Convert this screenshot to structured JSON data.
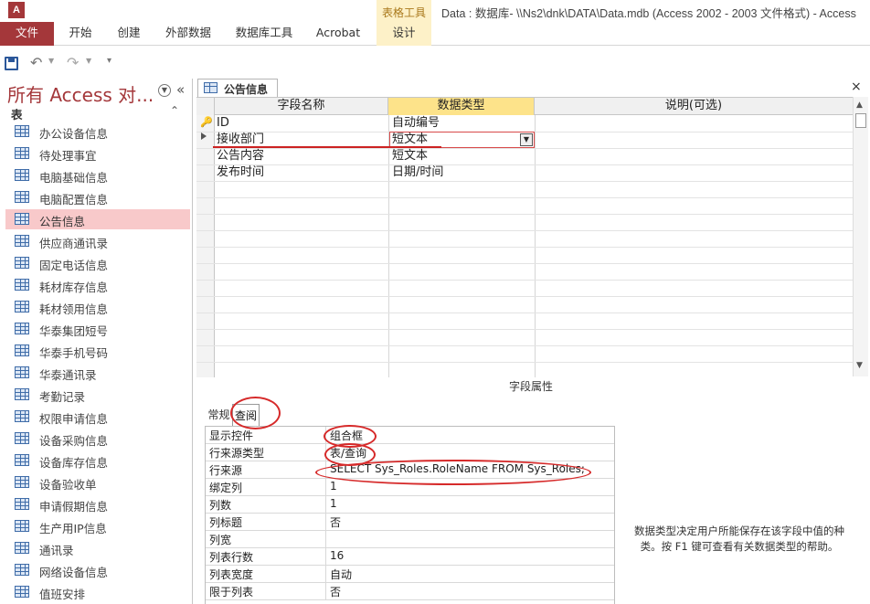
{
  "window": {
    "app_icon": "A",
    "title": "Data : 数据库- \\\\Ns2\\dnk\\DATA\\Data.mdb (Access 2002 - 2003 文件格式) - Access"
  },
  "ribbon": {
    "context_group": "表格工具",
    "tabs": {
      "file": "文件",
      "home": "开始",
      "create": "创建",
      "external": "外部数据",
      "dbtools": "数据库工具",
      "acrobat": "Acrobat",
      "design": "设计"
    }
  },
  "qat": {
    "icons": [
      "save-icon",
      "undo-icon",
      "redo-icon",
      "customize-icon"
    ]
  },
  "nav": {
    "title": "所有 Access 对...",
    "group_label": "表",
    "items": [
      "办公设备信息",
      "待处理事宜",
      "电脑基础信息",
      "电脑配置信息",
      "公告信息",
      "供应商通讯录",
      "固定电话信息",
      "耗材库存信息",
      "耗材领用信息",
      "华泰集团短号",
      "华泰手机号码",
      "华泰通讯录",
      "考勤记录",
      "权限申请信息",
      "设备采购信息",
      "设备库存信息",
      "设备验收单",
      "申请假期信息",
      "生产用IP信息",
      "通讯录",
      "网络设备信息",
      "值班安排"
    ],
    "selected_index": 4
  },
  "document": {
    "tab_label": "公告信息",
    "grid": {
      "headers": {
        "name": "字段名称",
        "type": "数据类型",
        "desc": "说明(可选)"
      },
      "rows": [
        {
          "name": "ID",
          "type": "自动编号"
        },
        {
          "name": "接收部门",
          "type": "短文本"
        },
        {
          "name": "公告内容",
          "type": "短文本"
        },
        {
          "name": "发布时间",
          "type": "日期/时间"
        }
      ]
    },
    "field_properties_title": "字段属性",
    "property_tabs": {
      "general": "常规",
      "lookup": "查阅"
    },
    "properties": [
      {
        "label": "显示控件",
        "value": "组合框"
      },
      {
        "label": "行来源类型",
        "value": "表/查询"
      },
      {
        "label": "行来源",
        "value": "SELECT Sys_Roles.RoleName FROM Sys_Roles;"
      },
      {
        "label": "绑定列",
        "value": "1"
      },
      {
        "label": "列数",
        "value": "1"
      },
      {
        "label": "列标题",
        "value": "否"
      },
      {
        "label": "列宽",
        "value": ""
      },
      {
        "label": "列表行数",
        "value": "16"
      },
      {
        "label": "列表宽度",
        "value": "自动"
      },
      {
        "label": "限于列表",
        "value": "否"
      }
    ],
    "help_text": "数据类型决定用户所能保存在该字段中值的种类。按 F1 键可查看有关数据类型的帮助。"
  },
  "colors": {
    "brand": "#a4373a",
    "context_bg": "#fdf1c8",
    "type_header": "#fde38a",
    "annotation": "#d62a2a"
  }
}
